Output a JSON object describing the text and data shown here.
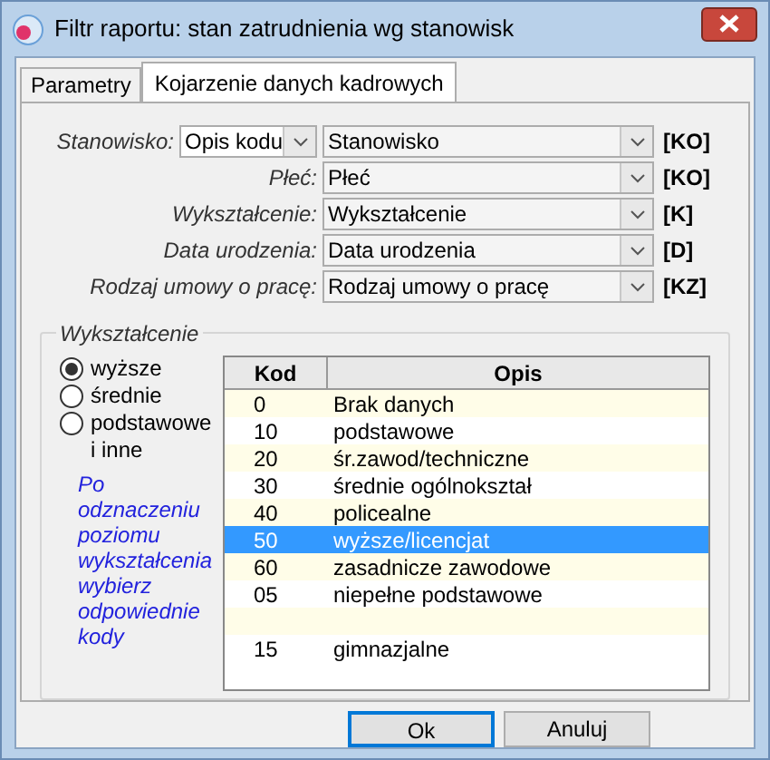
{
  "window": {
    "title": "Filtr raportu: stan zatrudnienia wg stanowisk"
  },
  "tabs": [
    {
      "label": "Parametry",
      "selected": false
    },
    {
      "label": "Kojarzenie danych kadrowych",
      "selected": true
    }
  ],
  "fields": [
    {
      "label": "Stanowisko:",
      "mode": "Opis kodu",
      "value": "Stanowisko",
      "tag": "[KO]"
    },
    {
      "label": "Płeć:",
      "value": "Płeć",
      "tag": "[KO]"
    },
    {
      "label": "Wykształcenie:",
      "value": "Wykształcenie",
      "tag": "[K]"
    },
    {
      "label": "Data urodzenia:",
      "value": "Data urodzenia",
      "tag": "[D]"
    },
    {
      "label": "Rodzaj umowy o pracę:",
      "value": "Rodzaj umowy o pracę",
      "tag": "[KZ]"
    }
  ],
  "group": {
    "title": "Wykształcenie",
    "radios": [
      {
        "label": "wyższe",
        "selected": true
      },
      {
        "label": "średnie",
        "selected": false
      },
      {
        "label": "podstawowe i inne",
        "selected": false
      }
    ],
    "hint": "Po odznaczeniu poziomu wykształcenia wybierz odpowiednie kody",
    "table": {
      "columns": [
        "Kod",
        "Opis"
      ],
      "rows": [
        {
          "kod": "0",
          "opis": "Brak danych",
          "selected": false
        },
        {
          "kod": "10",
          "opis": "podstawowe",
          "selected": false
        },
        {
          "kod": "20",
          "opis": "śr.zawod/techniczne",
          "selected": false
        },
        {
          "kod": "30",
          "opis": "średnie ogólnokształ",
          "selected": false
        },
        {
          "kod": "40",
          "opis": "policealne",
          "selected": false
        },
        {
          "kod": "50",
          "opis": "wyższe/licencjat",
          "selected": true
        },
        {
          "kod": "60",
          "opis": "zasadnicze zawodowe",
          "selected": false
        },
        {
          "kod": "05",
          "opis": "niepełne podstawowe",
          "selected": false
        },
        {
          "selected": false
        },
        {
          "kod": "15",
          "opis": "gimnazjalne",
          "selected": false
        }
      ]
    }
  },
  "buttons": [
    {
      "label": "Ok",
      "default": true
    },
    {
      "label": "Anuluj",
      "default": false
    }
  ]
}
